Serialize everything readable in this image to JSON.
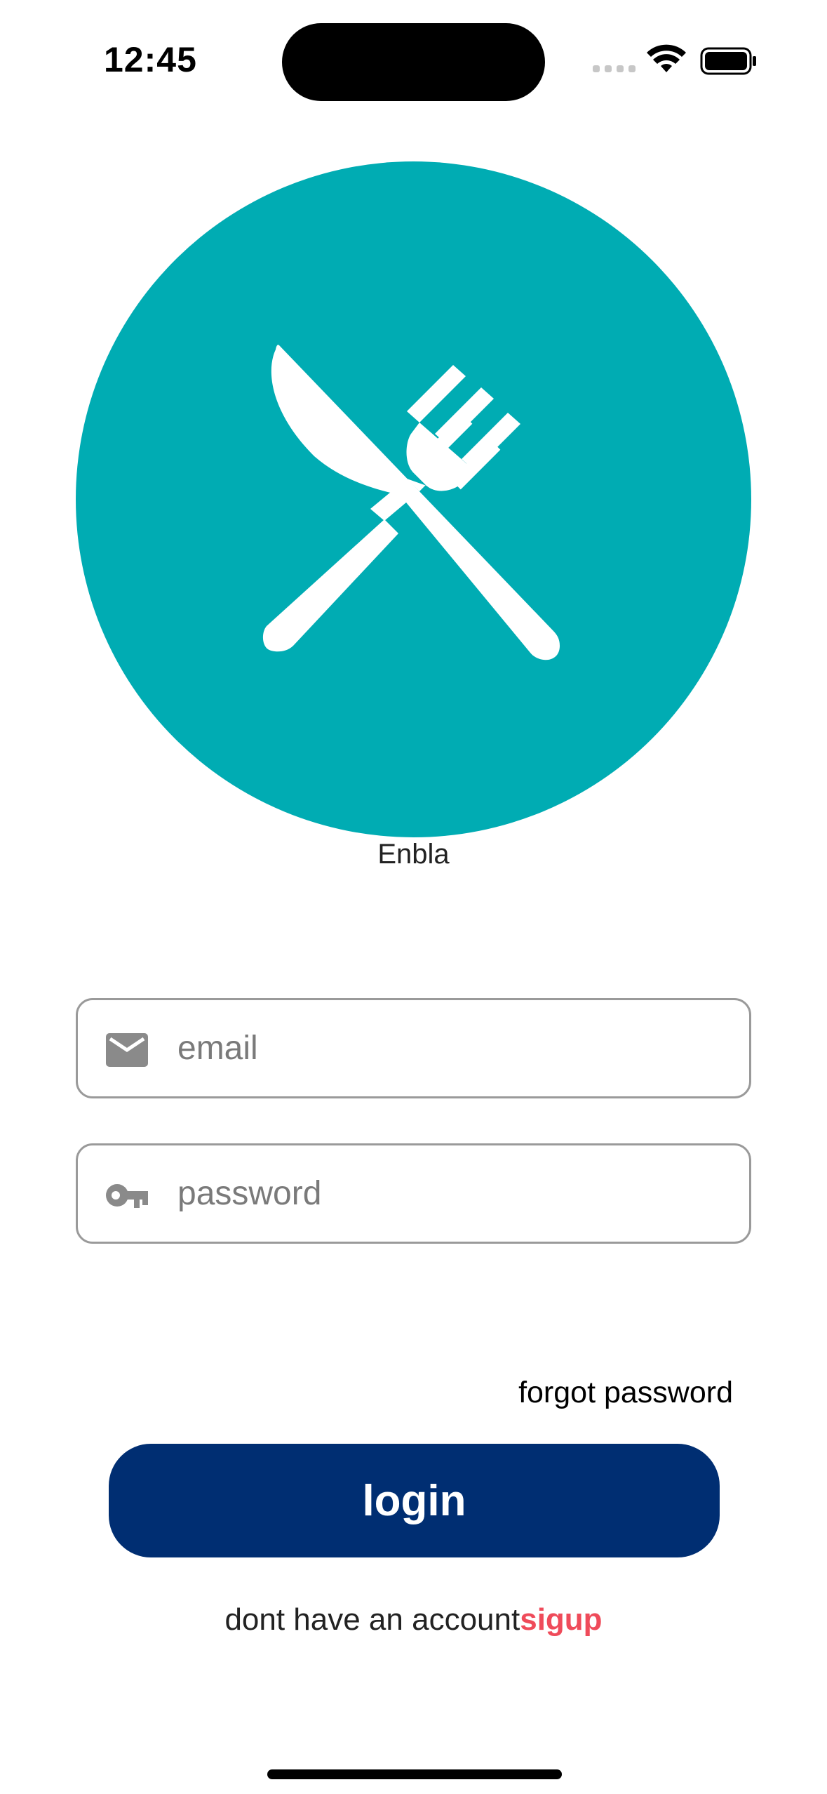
{
  "status_bar": {
    "time": "12:45"
  },
  "logo": {
    "icon": "fork-knife-icon",
    "background_color": "#00acb3"
  },
  "app": {
    "name": "Enbla"
  },
  "form": {
    "email": {
      "icon": "mail-icon",
      "placeholder": "email",
      "value": ""
    },
    "password": {
      "icon": "key-icon",
      "placeholder": "password",
      "value": ""
    }
  },
  "links": {
    "forgot_password": "forgot password"
  },
  "buttons": {
    "login": "login",
    "login_color": "#002e72"
  },
  "signup": {
    "prompt": "dont have an account",
    "link": "sigup",
    "link_color": "#ef4b5a"
  }
}
